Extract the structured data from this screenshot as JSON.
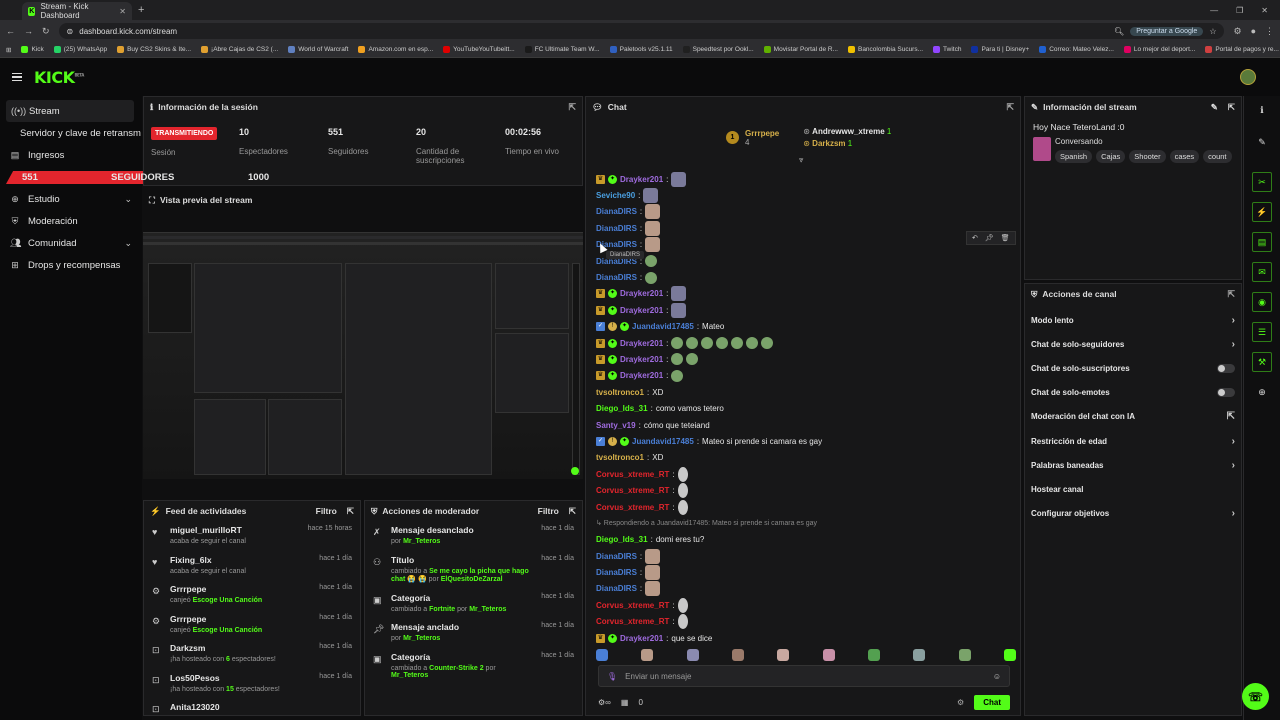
{
  "browser": {
    "tab_title": "Stream - Kick Dashboard",
    "url": "dashboard.kick.com/stream",
    "google_btn": "Preguntar a Google",
    "bookmarks": [
      "Kick",
      "(25) WhatsApp",
      "Buy CS2 Skins & Ite...",
      "¡Abre Cajas de CS2 (...",
      "World of Warcraft",
      "Amazon.com en esp...",
      "YouTubeYouTubeitt...",
      "FC Ultimate Team W...",
      "Paletools v25.1.11",
      "Speedtest por Ookl...",
      "Movistar Portal de R...",
      "Bancolombia Sucurs...",
      "Twitch",
      "Para ti | Disney+",
      "Correo: Mateo Velez...",
      "Lo mejor del deport...",
      "Portal de pagos y re..."
    ]
  },
  "brand": {
    "logo": "KICK",
    "accent": "#53fc18",
    "live_red": "#e3252d"
  },
  "nav": {
    "items": [
      {
        "label": "Stream",
        "icon": "broadcast-icon"
      },
      {
        "label": "Servidor y clave de retransm"
      },
      {
        "label": "Ingresos",
        "icon": "money-icon"
      },
      {
        "label": "Estudio",
        "icon": "studio-icon"
      },
      {
        "label": "Moderación",
        "icon": "shield-icon"
      },
      {
        "label": "Comunidad",
        "icon": "people-icon"
      },
      {
        "label": "Drops y recompensas",
        "icon": "gift-icon"
      }
    ],
    "goal_current": "551",
    "goal_label": "SEGUIDORES",
    "goal_target": "1000",
    "goal_progress": 0.551
  },
  "session": {
    "title": "Información de la sesión",
    "status": "TRANSMITIENDO",
    "status_label": "Sesión",
    "stats": [
      {
        "value": "10",
        "label": "Espectadores"
      },
      {
        "value": "551",
        "label": "Seguidores"
      },
      {
        "value": "20",
        "label": "Cantidad de suscripciones"
      },
      {
        "value": "00:02:56",
        "label": "Tiempo en vivo"
      }
    ]
  },
  "preview": {
    "title": "Vista previa del stream"
  },
  "feed": {
    "title": "Feed de actividades",
    "filter": "Filtro",
    "items": [
      {
        "name": "miguel_murilloRT",
        "desc": "acaba de seguir el canal",
        "time": "hace 15 horas",
        "icon": "heart-icon"
      },
      {
        "name": "Fixing_6lx",
        "desc": "acaba de seguir el canal",
        "time": "hace 1 día",
        "icon": "heart-icon"
      },
      {
        "name": "Grrrpepe",
        "desc_pre": "canjeó",
        "desc_em": "Escoge Una Canción",
        "time": "hace 1 día",
        "icon": "reward-icon"
      },
      {
        "name": "Grrrpepe",
        "desc_pre": "canjeó",
        "desc_em": "Escoge Una Canción",
        "time": "hace 1 día",
        "icon": "reward-icon"
      },
      {
        "name": "Darkzsm",
        "desc_pre": "¡ha hosteado con",
        "desc_em": "6",
        "desc_post": "espectadores!",
        "time": "hace 1 día",
        "icon": "host-icon"
      },
      {
        "name": "Los50Pesos",
        "desc_pre": "¡ha hosteado con",
        "desc_em": "15",
        "desc_post": "espectadores!",
        "time": "hace 1 día",
        "icon": "host-icon"
      },
      {
        "name": "Anita123020",
        "desc": "",
        "time": "",
        "icon": "host-icon"
      }
    ]
  },
  "modactions": {
    "title": "Acciones de moderador",
    "filter": "Filtro",
    "items": [
      {
        "name": "Mensaje desanclado",
        "pre": "por",
        "user": "Mr_Teteros",
        "time": "hace 1 día",
        "icon": "unpin-icon"
      },
      {
        "name": "Título",
        "pre": "cambiado a",
        "detail": "Se me cayo la picha que hago chat 😭 😭",
        "mid": "por",
        "user": "ElQuesitoDeZarzal",
        "time": "hace 1 día",
        "icon": "title-icon"
      },
      {
        "name": "Categoría",
        "pre": "cambiado a",
        "detail": "Fortnite",
        "mid": "por",
        "user": "Mr_Teteros",
        "time": "hace 1 día",
        "icon": "category-icon"
      },
      {
        "name": "Mensaje anclado",
        "pre": "por",
        "user": "Mr_Teteros",
        "time": "hace 1 día",
        "icon": "pin-icon"
      },
      {
        "name": "Categoría",
        "pre": "cambiado a",
        "detail": "Counter-Strike 2",
        "mid": "por",
        "user": "Mr_Teteros",
        "time": "hace 1 día",
        "icon": "category-icon"
      }
    ]
  },
  "chat": {
    "title": "Chat",
    "pinned": [
      {
        "name": "Grrrpepe",
        "count": "4"
      },
      {
        "name": "Andrewww_xtreme",
        "count": "1"
      },
      {
        "name": "Darkzsm",
        "count": "1"
      }
    ],
    "messages": [
      {
        "user": "Drayker201",
        "color": "#a06ce0",
        "badges": [
          "c",
          "s"
        ],
        "text": "",
        "emotes": [
          "b"
        ]
      },
      {
        "user": "Seviche90",
        "color": "#4a9fe0",
        "badges": [],
        "text": "",
        "emotes": [
          "b"
        ]
      },
      {
        "user": "DianaDIRS",
        "color": "#4a7fd6",
        "badges": [],
        "text": "",
        "emotes": [
          "e"
        ]
      },
      {
        "user": "DianaDIRS",
        "color": "#4a7fd6",
        "badges": [],
        "text": "",
        "emotes": [
          "e"
        ]
      },
      {
        "user": "DianaDIRS",
        "color": "#4a7fd6",
        "badges": [],
        "text": "",
        "emotes": [
          "e"
        ]
      },
      {
        "user": "DianaDIRS",
        "color": "#4a7fd6",
        "badges": [],
        "text": "",
        "emotes": [
          "g"
        ]
      },
      {
        "user": "DianaDIRS",
        "color": "#4a7fd6",
        "badges": [],
        "text": "",
        "emotes": [
          "g"
        ]
      },
      {
        "user": "Drayker201",
        "color": "#a06ce0",
        "badges": [
          "c",
          "s"
        ],
        "text": "",
        "emotes": [
          "b"
        ]
      },
      {
        "user": "Drayker201",
        "color": "#a06ce0",
        "badges": [
          "c",
          "s"
        ],
        "text": "",
        "emotes": [
          "b"
        ]
      },
      {
        "user": "Juandavid17485",
        "color": "#4a7fd6",
        "badges": [
          "v",
          "o",
          "s"
        ],
        "text": "Mateo",
        "emotes": []
      },
      {
        "user": "Drayker201",
        "color": "#a06ce0",
        "badges": [
          "c",
          "s"
        ],
        "text": "",
        "emotes": [
          "g",
          "g",
          "g",
          "g",
          "g",
          "g",
          "g"
        ]
      },
      {
        "user": "Drayker201",
        "color": "#a06ce0",
        "badges": [
          "c",
          "s"
        ],
        "text": "",
        "emotes": [
          "g",
          "g"
        ]
      },
      {
        "user": "Drayker201",
        "color": "#a06ce0",
        "badges": [
          "c",
          "s"
        ],
        "text": "",
        "emotes": [
          "g"
        ]
      },
      {
        "user": "tvsoltronco1",
        "color": "#d6b04a",
        "badges": [],
        "text": "XD",
        "emotes": []
      },
      {
        "user": "Diego_lds_31",
        "color": "#53fc18",
        "badges": [],
        "text": "como vamos tetero",
        "emotes": []
      },
      {
        "user": "Santy_v19",
        "color": "#a06ce0",
        "badges": [],
        "text": "cómo que teteiand",
        "emotes": []
      },
      {
        "user": "Juandavid17485",
        "color": "#4a7fd6",
        "badges": [
          "v",
          "o",
          "s"
        ],
        "text": "Mateo si prende si camara es gay",
        "emotes": []
      },
      {
        "user": "tvsoltronco1",
        "color": "#d6b04a",
        "badges": [],
        "text": "XD",
        "emotes": []
      },
      {
        "user": "Corvus_xtreme_RT",
        "color": "#e3252d",
        "badges": [],
        "text": "",
        "emotes": [
          "w"
        ]
      },
      {
        "user": "Corvus_xtreme_RT",
        "color": "#e3252d",
        "badges": [],
        "text": "",
        "emotes": [
          "w"
        ]
      },
      {
        "user": "Corvus_xtreme_RT",
        "color": "#e3252d",
        "badges": [],
        "text": "",
        "emotes": [
          "w"
        ]
      },
      {
        "reply": "Respondiendo a Juandavid17485: Mateo si prende si camara es gay"
      },
      {
        "user": "Diego_lds_31",
        "color": "#53fc18",
        "badges": [],
        "text": "domi eres tu?",
        "emotes": []
      },
      {
        "user": "DianaDIRS",
        "color": "#4a7fd6",
        "badges": [],
        "text": "",
        "emotes": [
          "e"
        ]
      },
      {
        "user": "DianaDIRS",
        "color": "#4a7fd6",
        "badges": [],
        "text": "",
        "emotes": [
          "e"
        ]
      },
      {
        "user": "DianaDIRS",
        "color": "#4a7fd6",
        "badges": [],
        "text": "",
        "emotes": [
          "e"
        ]
      },
      {
        "user": "Corvus_xtreme_RT",
        "color": "#e3252d",
        "badges": [],
        "text": "",
        "emotes": [
          "w"
        ]
      },
      {
        "user": "Corvus_xtreme_RT",
        "color": "#e3252d",
        "badges": [],
        "text": "",
        "emotes": [
          "w"
        ]
      },
      {
        "user": "Drayker201",
        "color": "#a06ce0",
        "badges": [
          "c",
          "s"
        ],
        "text": "que se dice",
        "emotes": []
      }
    ],
    "tooltip": "DianaDIRS",
    "input_placeholder": "Enviar un mensaje",
    "points": "0",
    "send_label": "Chat"
  },
  "streaminfo": {
    "title": "Información del stream",
    "stream_title": "Hoy Nace TeteroLand :0",
    "category": "Conversando",
    "tags": [
      "Spanish",
      "Cajas",
      "Shooter",
      "cases",
      "count"
    ]
  },
  "channelactions": {
    "title": "Acciones de canal",
    "items": [
      {
        "label": "Modo lento",
        "type": "arrow"
      },
      {
        "label": "Chat de solo-seguidores",
        "type": "arrow"
      },
      {
        "label": "Chat de solo-suscriptores",
        "type": "toggle"
      },
      {
        "label": "Chat de solo-emotes",
        "type": "toggle"
      },
      {
        "label": "Moderación del chat con IA",
        "type": "external"
      },
      {
        "label": "Restricción de edad",
        "type": "arrow"
      },
      {
        "label": "Palabras baneadas",
        "type": "arrow"
      },
      {
        "label": "Hostear canal",
        "type": "none"
      },
      {
        "label": "Configurar objetivos",
        "type": "arrow"
      }
    ]
  }
}
